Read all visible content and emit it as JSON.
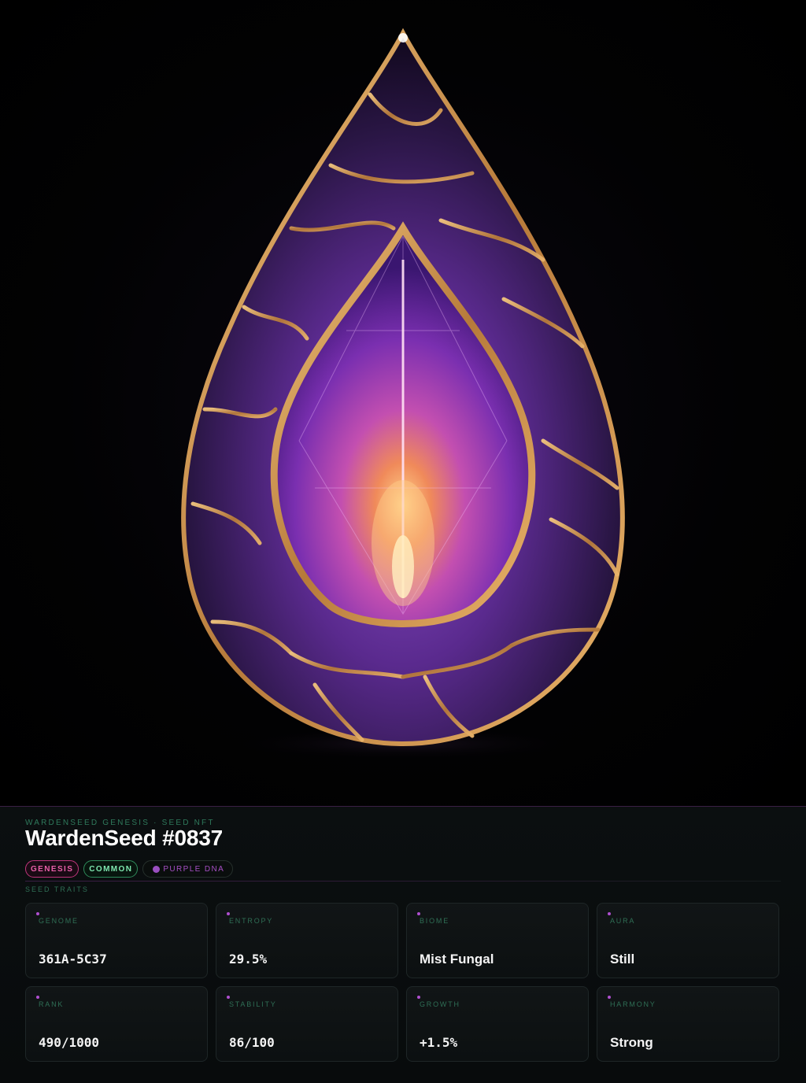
{
  "artwork": {
    "subject": "purple-crystal-teardrop-seed-with-gold-veins-icon"
  },
  "header": {
    "eyebrow": "WARDENSEED GENESIS · SEED NFT",
    "title": "WardenSeed #0837"
  },
  "badges": {
    "genesis": "GENESIS",
    "common": "COMMON",
    "dna": "PURPLE DNA"
  },
  "traits": {
    "section_label": "SEED TRAITS",
    "items": [
      {
        "label": "GENOME",
        "value": "361A-5C37"
      },
      {
        "label": "ENTROPY",
        "value": "29.5%"
      },
      {
        "label": "BIOME",
        "value": "Mist Fungal"
      },
      {
        "label": "AURA",
        "value": "Still"
      },
      {
        "label": "RANK",
        "value": "490/1000"
      },
      {
        "label": "STABILITY",
        "value": "86/100"
      },
      {
        "label": "GROWTH",
        "value": "+1.5%"
      },
      {
        "label": "HARMONY",
        "value": "Strong"
      }
    ]
  },
  "colors": {
    "background": "#000000",
    "panel": "#0b0f10",
    "accent_pink": "#e85fa8",
    "accent_green": "#7fe8b0",
    "accent_purple": "#9a4fc0",
    "label_green": "#2f6f55",
    "gold": "#c8924a"
  }
}
